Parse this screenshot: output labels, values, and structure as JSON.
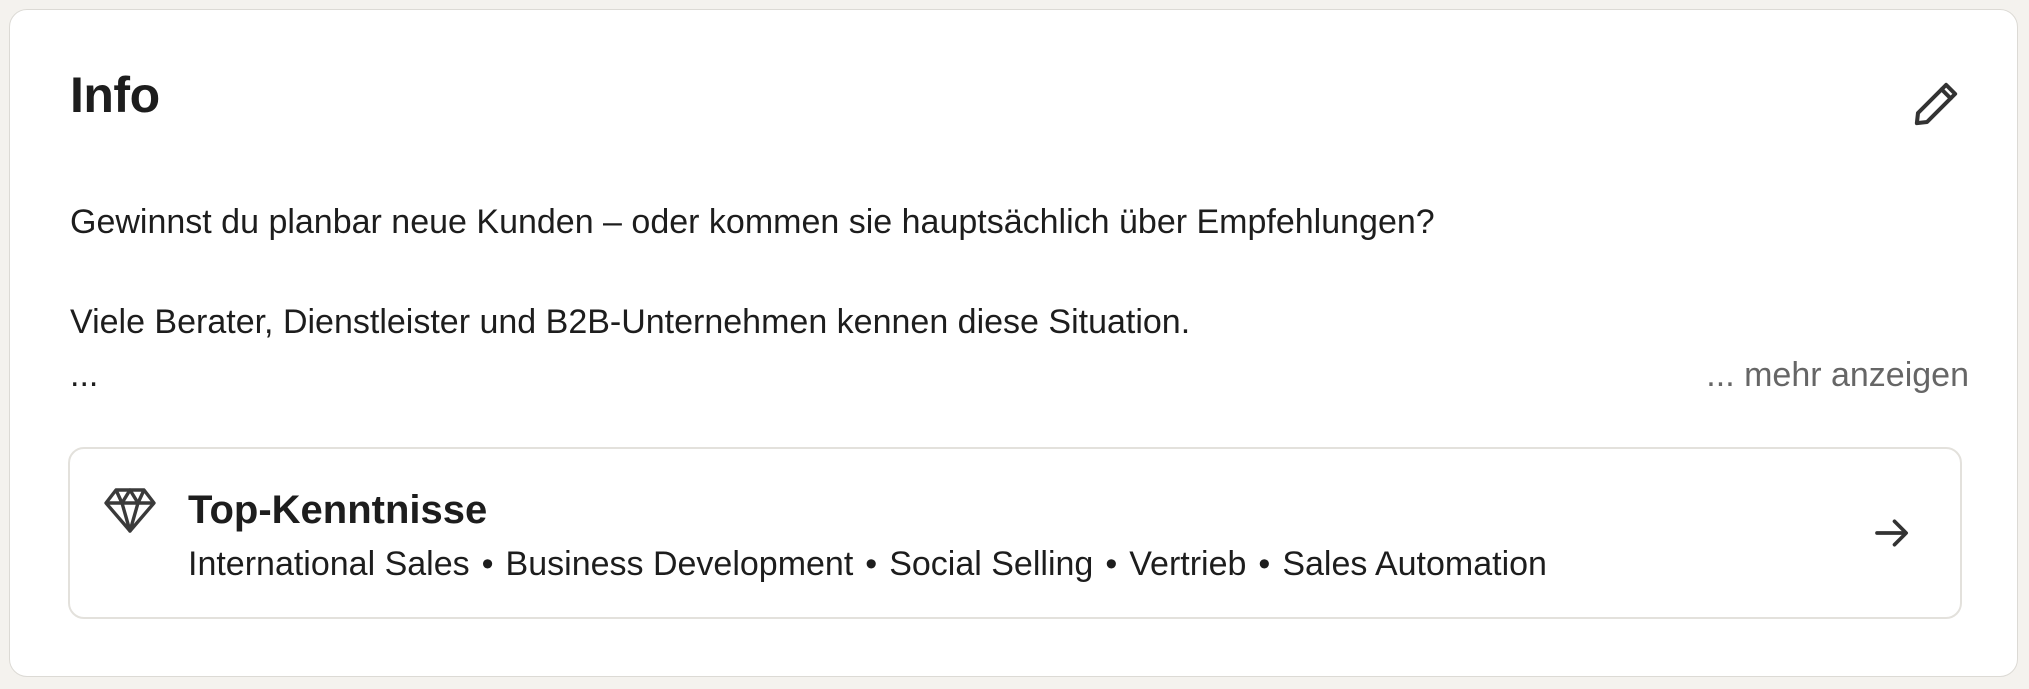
{
  "section": {
    "title": "Info",
    "edit_icon": "pencil-icon"
  },
  "about": {
    "paragraph_1": "Gewinnst du planbar neue Kunden – oder kommen sie hauptsächlich über Empfehlungen?",
    "paragraph_2": "Viele Berater, Dienstleister und B2B-Unternehmen kennen diese Situation.",
    "ellipsis": "...",
    "see_more_label": "... mehr anzeigen"
  },
  "top_skills": {
    "icon": "diamond-icon",
    "title": "Top-Kenntnisse",
    "items": [
      "International Sales",
      "Business Development",
      "Social Selling",
      "Vertrieb",
      "Sales Automation"
    ],
    "separator": "•",
    "arrow_icon": "arrow-right-icon"
  },
  "colors": {
    "background": "#f4f2ee",
    "card": "#ffffff",
    "text": "#1d1d1d",
    "muted": "#666666",
    "border": "#e3e1dc"
  }
}
